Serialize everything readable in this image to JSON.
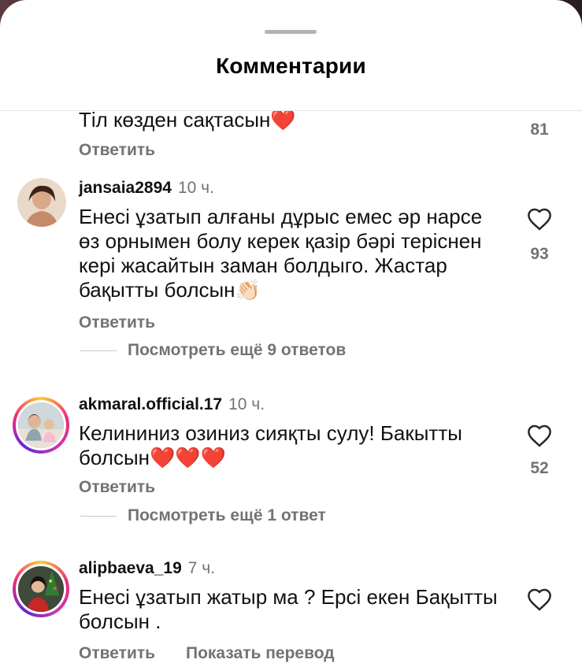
{
  "sheet": {
    "title": "Комментарии"
  },
  "comments": [
    {
      "text": "Тіл көзден сақтасын❤️",
      "likes": "81",
      "reply": "Ответить"
    },
    {
      "username": "jansaia2894",
      "time": "10 ч.",
      "text": "Енесі ұзатып алғаны дұрыс емес әр нарсе өз орнымен болу керек қазір бәрі теріснен кері жасайтын заман болдыго. Жастар бақытты болсын👏🏻",
      "likes": "93",
      "reply": "Ответить",
      "more": "Посмотреть ещё 9 ответов"
    },
    {
      "username": "akmaral.official.17",
      "time": "10 ч.",
      "text": "Келининиз озиниз сияқты сулу! Бакытты болсын❤️❤️❤️",
      "likes": "52",
      "reply": "Ответить",
      "more": "Посмотреть ещё 1 ответ"
    },
    {
      "username": "alipbaeva_19",
      "time": "7 ч.",
      "text": "Енесі ұзатып жатыр ма ? Ерсі екен Бақытты болсын .",
      "reply": "Ответить",
      "translate": "Показать перевод"
    }
  ],
  "icons": {
    "like": "heart-outline-icon"
  },
  "colors": {
    "muted": "#737373",
    "story_ring": "#ee2a7b"
  }
}
